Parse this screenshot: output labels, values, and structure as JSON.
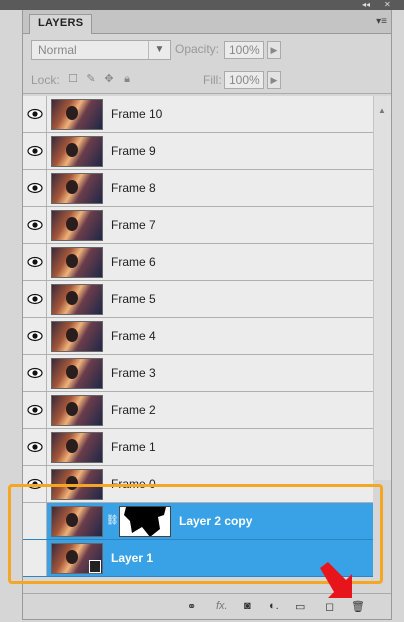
{
  "panel": {
    "tab_label": "LAYERS",
    "blend_mode": "Normal",
    "opacity_label": "Opacity:",
    "opacity_value": "100%",
    "lock_label": "Lock:",
    "fill_label": "Fill:",
    "fill_value": "100%"
  },
  "layers": [
    {
      "name": "Frame 10",
      "visible": true,
      "selected": false
    },
    {
      "name": "Frame 9",
      "visible": true,
      "selected": false
    },
    {
      "name": "Frame 8",
      "visible": true,
      "selected": false
    },
    {
      "name": "Frame 7",
      "visible": true,
      "selected": false
    },
    {
      "name": "Frame 6",
      "visible": true,
      "selected": false
    },
    {
      "name": "Frame 5",
      "visible": true,
      "selected": false
    },
    {
      "name": "Frame 4",
      "visible": true,
      "selected": false
    },
    {
      "name": "Frame 3",
      "visible": true,
      "selected": false
    },
    {
      "name": "Frame 2",
      "visible": true,
      "selected": false
    },
    {
      "name": "Frame 1",
      "visible": true,
      "selected": false
    },
    {
      "name": "Frame 0",
      "visible": true,
      "selected": false
    },
    {
      "name": "Layer 2 copy",
      "visible": false,
      "selected": true,
      "has_mask": true
    },
    {
      "name": "Layer 1",
      "visible": false,
      "selected": true,
      "has_mask": false
    }
  ],
  "bottom_icons": [
    "link-icon",
    "fx-icon",
    "mask-icon",
    "adjustment-icon",
    "folder-icon",
    "new-layer-icon",
    "trash-icon"
  ],
  "colors": {
    "selection": "#39a2e6",
    "highlight": "#f5a623",
    "arrow": "#e8141c"
  }
}
